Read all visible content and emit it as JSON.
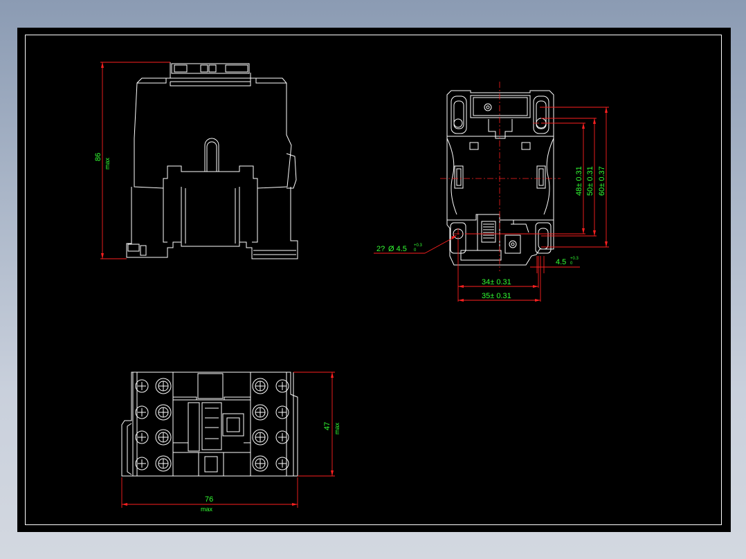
{
  "drawing": {
    "side_view": {
      "height_value": "86",
      "height_qualifier": "max"
    },
    "front_view": {
      "hole_callout_prefix": "2?",
      "hole_callout_diameter": "Ø 4.5",
      "hole_callout_tol_upper": "+0.3",
      "hole_callout_tol_lower": "0",
      "slot_width": "4.5",
      "slot_tol_upper": "+0.3",
      "slot_tol_lower": "0",
      "dim_34": "34± 0.31",
      "dim_35": "35± 0.31",
      "dim_48": "48± 0.31",
      "dim_50": "50± 0.31",
      "dim_60": "60± 0.37"
    },
    "top_view": {
      "depth_value": "47",
      "depth_qualifier": "max",
      "width_value": "76",
      "width_qualifier": "max"
    }
  },
  "colors": {
    "background": "#000000",
    "outline": "#ffffff",
    "dimension_line": "#ff2020",
    "dimension_text": "#33ff33",
    "frame": "#ffffff"
  }
}
